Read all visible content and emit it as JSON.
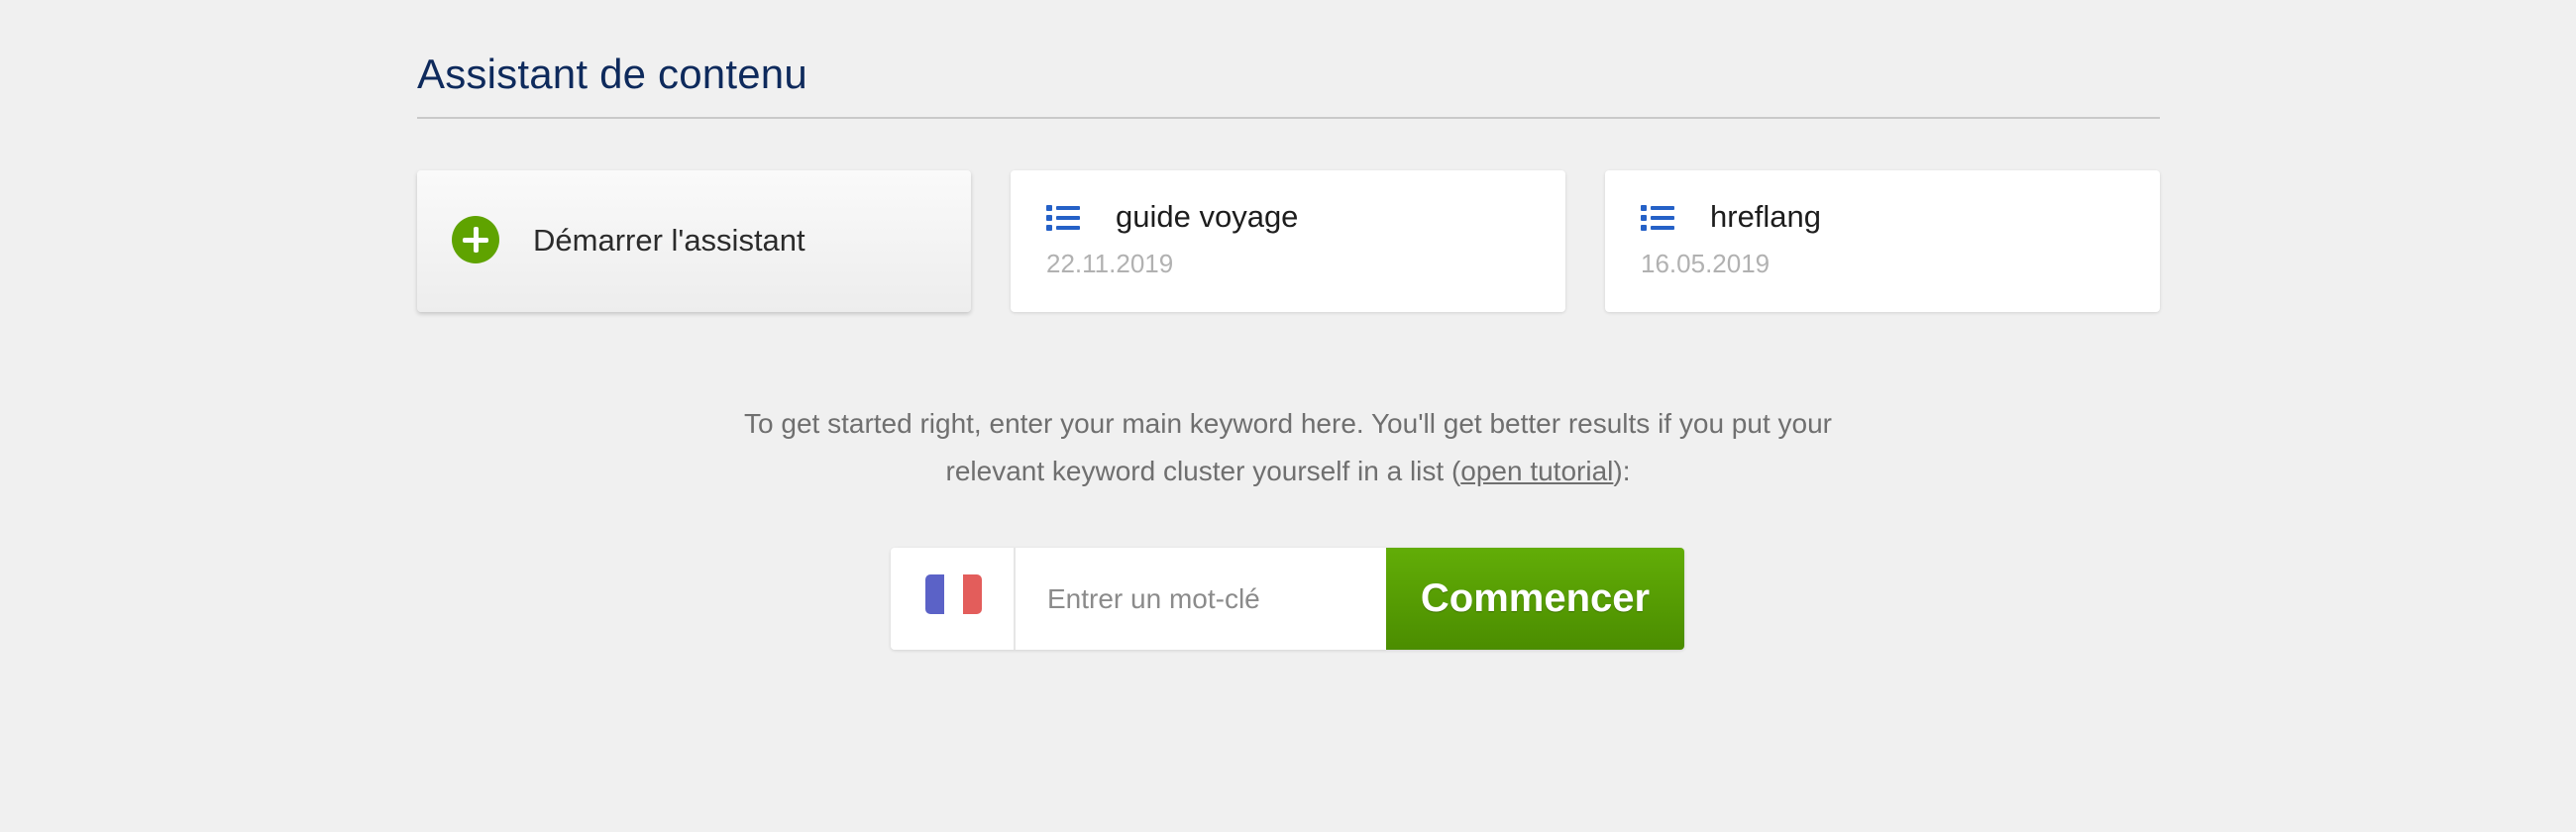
{
  "header": {
    "title": "Assistant de contenu"
  },
  "cards": {
    "start": {
      "label": "Démarrer l'assistant",
      "icon": "plus-circle-icon",
      "icon_color": "#5fa300"
    },
    "items": [
      {
        "name": "guide voyage",
        "date": "22.11.2019",
        "icon": "list-icon"
      },
      {
        "name": "hreflang",
        "date": "16.05.2019",
        "icon": "list-icon"
      }
    ],
    "icon_color": "#2561c7"
  },
  "intro": {
    "text_before": "To get started right, enter your main keyword here. You'll get better results if you put your relevant keyword cluster yourself in a list (",
    "link_text": "open tutorial",
    "text_after": "):"
  },
  "search": {
    "country_flag": "france-flag-icon",
    "placeholder": "Entrer un mot-clé",
    "value": "",
    "button_label": "Commencer",
    "button_color": "#5a9f05"
  }
}
